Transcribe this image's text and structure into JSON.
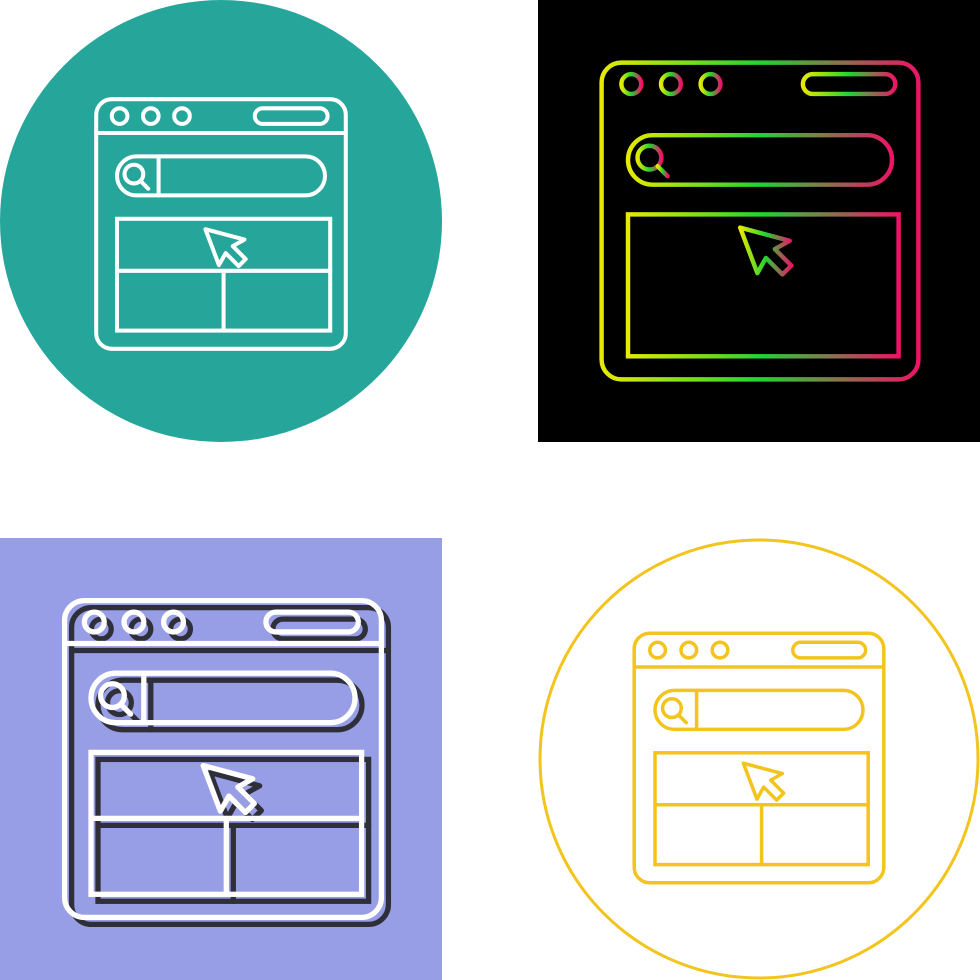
{
  "icons": [
    {
      "name": "website-icon-teal",
      "style": "line-white-on-circle",
      "background": "#26a69a",
      "stroke": "#ffffff",
      "icon": "browser-window-search-cursor-icon"
    },
    {
      "name": "website-icon-gradient",
      "style": "line-gradient-on-black",
      "background": "#000000",
      "stroke_from": "#e6ea00",
      "stroke_mid": "#22d332",
      "stroke_to": "#ec1466",
      "icon": "browser-window-search-cursor-icon"
    },
    {
      "name": "website-icon-shadow",
      "style": "line-white-with-shadow-on-square",
      "background": "#979ee6",
      "stroke": "#ffffff",
      "shadow": "#2f2f3a",
      "icon": "browser-window-search-cursor-icon"
    },
    {
      "name": "website-icon-yellow",
      "style": "line-yellow-in-circle-outline",
      "background": "#ffffff",
      "stroke": "#f2c41d",
      "icon": "browser-window-search-cursor-icon"
    }
  ]
}
